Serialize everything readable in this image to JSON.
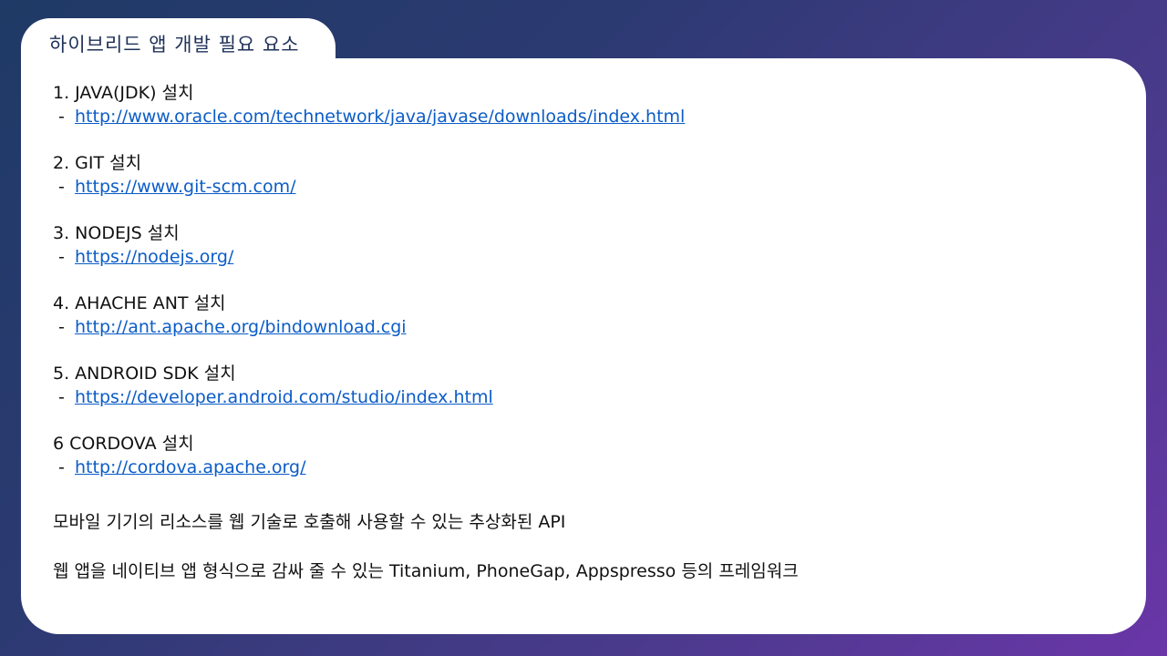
{
  "title": "하이브리드 앱 개발 필요 요소",
  "steps": [
    {
      "heading": "1. JAVA(JDK) 설치",
      "dash": "-",
      "url": "http://www.oracle.com/technetwork/java/javase/downloads/index.html"
    },
    {
      "heading": "2. GIT 설치",
      "dash": "-",
      "url": "https://www.git-scm.com/"
    },
    {
      "heading": "3. NODEJS 설치",
      "dash": "-",
      "url": "https://nodejs.org/"
    },
    {
      "heading": "4. AHACHE  ANT 설치",
      "dash": "-",
      "url": "http://ant.apache.org/bindownload.cgi"
    },
    {
      "heading": "5. ANDROID  SDK 설치",
      "dash": "-",
      "url": "https://developer.android.com/studio/index.html"
    },
    {
      "heading": "6 CORDOVA  설치",
      "dash": "-",
      "url": "http://cordova.apache.org/"
    }
  ],
  "notes": [
    "모바일 기기의 리소스를 웹 기술로 호출해 사용할 수 있는 추상화된 API",
    "웹 앱을 네이티브 앱 형식으로 감싸 줄 수 있는 Titanium,  PhoneGap, Appspresso 등의 프레임워크"
  ],
  "colors": {
    "link": "#0b5cc7",
    "title": "#1f3158",
    "background_start": "#1f3a66",
    "background_end": "#6a36a8"
  }
}
